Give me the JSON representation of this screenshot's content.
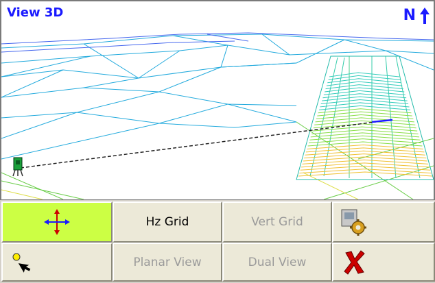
{
  "view": {
    "title": "View 3D",
    "north_label": "N",
    "north_icon": "north-arrow-icon"
  },
  "toolbar": {
    "pan_button": {
      "icon": "pan-move-icon",
      "active": true
    },
    "hz_grid_label": "Hz Grid",
    "vert_grid_label": "Vert Grid",
    "settings_button": {
      "icon": "settings-gear-icon"
    },
    "select_point_button": {
      "icon": "select-point-icon"
    },
    "planar_view_label": "Planar View",
    "dual_view_label": "Dual View",
    "close_button": {
      "icon": "close-x-icon"
    }
  },
  "colors": {
    "title_blue": "#1a1aff",
    "active_button": "#ccff44",
    "disabled_text": "#9a9a9a",
    "close_red": "#cc0000"
  }
}
